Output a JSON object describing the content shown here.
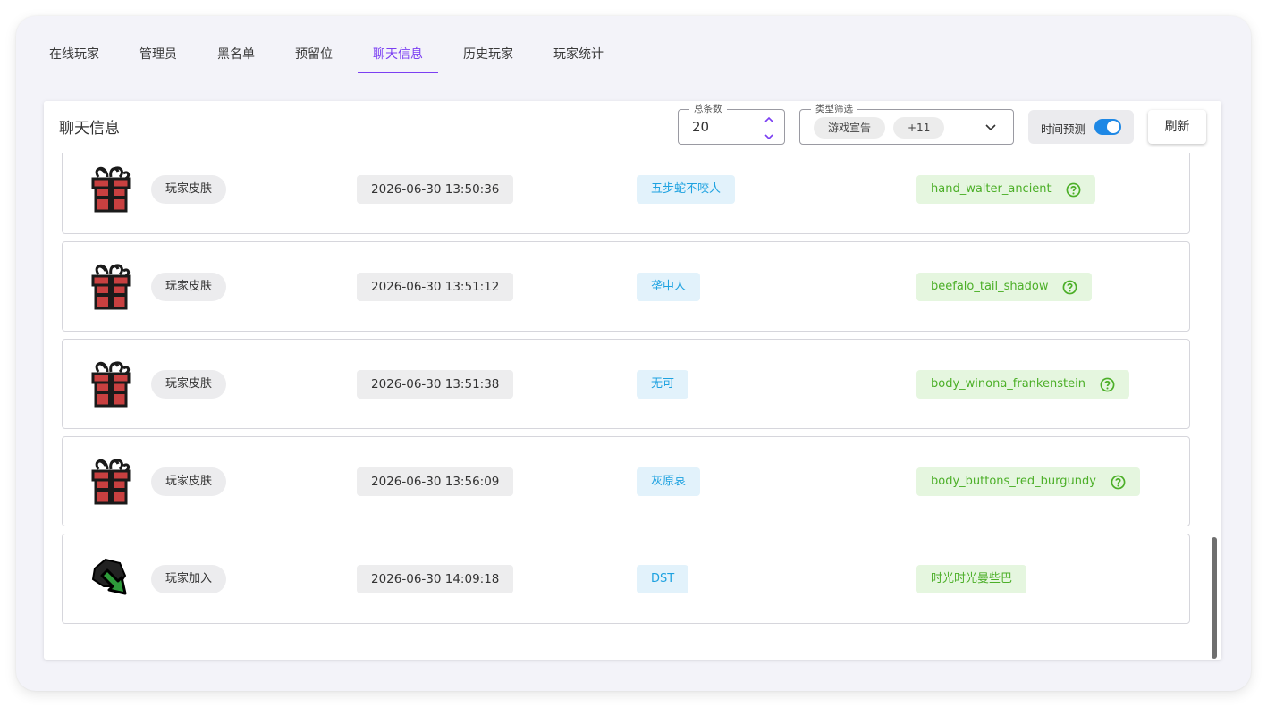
{
  "tabs": [
    "在线玩家",
    "管理员",
    "黑名单",
    "预留位",
    "聊天信息",
    "历史玩家",
    "玩家统计"
  ],
  "active_tab": "聊天信息",
  "card": {
    "title": "聊天信息",
    "count": {
      "legend": "总条数",
      "value": "20"
    },
    "filter": {
      "legend": "类型筛选",
      "chips": [
        "游戏宣告",
        "+11"
      ]
    },
    "time_predict": {
      "label": "时间预测",
      "enabled": true
    },
    "refresh_label": "刷新"
  },
  "rows": [
    {
      "icon": "gift-icon",
      "type": "玩家皮肤",
      "time": "2026-06-30 13:50:36",
      "player": "五步蛇不咬人",
      "message": "hand_walter_ancient",
      "help": true
    },
    {
      "icon": "gift-icon",
      "type": "玩家皮肤",
      "time": "2026-06-30 13:51:12",
      "player": "垄中人",
      "message": "beefalo_tail_shadow",
      "help": true
    },
    {
      "icon": "gift-icon",
      "type": "玩家皮肤",
      "time": "2026-06-30 13:51:38",
      "player": "无可",
      "message": "body_winona_frankenstein",
      "help": true
    },
    {
      "icon": "gift-icon",
      "type": "玩家皮肤",
      "time": "2026-06-30 13:56:09",
      "player": "灰原哀",
      "message": "body_buttons_red_burgundy",
      "help": true
    },
    {
      "icon": "join-arrow-icon",
      "type": "玩家加入",
      "time": "2026-06-30 14:09:18",
      "player": "DST",
      "message": "时光时光曼些巴",
      "help": false
    }
  ],
  "colors": {
    "accent": "#7b3ff2",
    "switch": "#1e88e5",
    "player_text": "#1ea2e0",
    "message_text": "#4caf28"
  }
}
